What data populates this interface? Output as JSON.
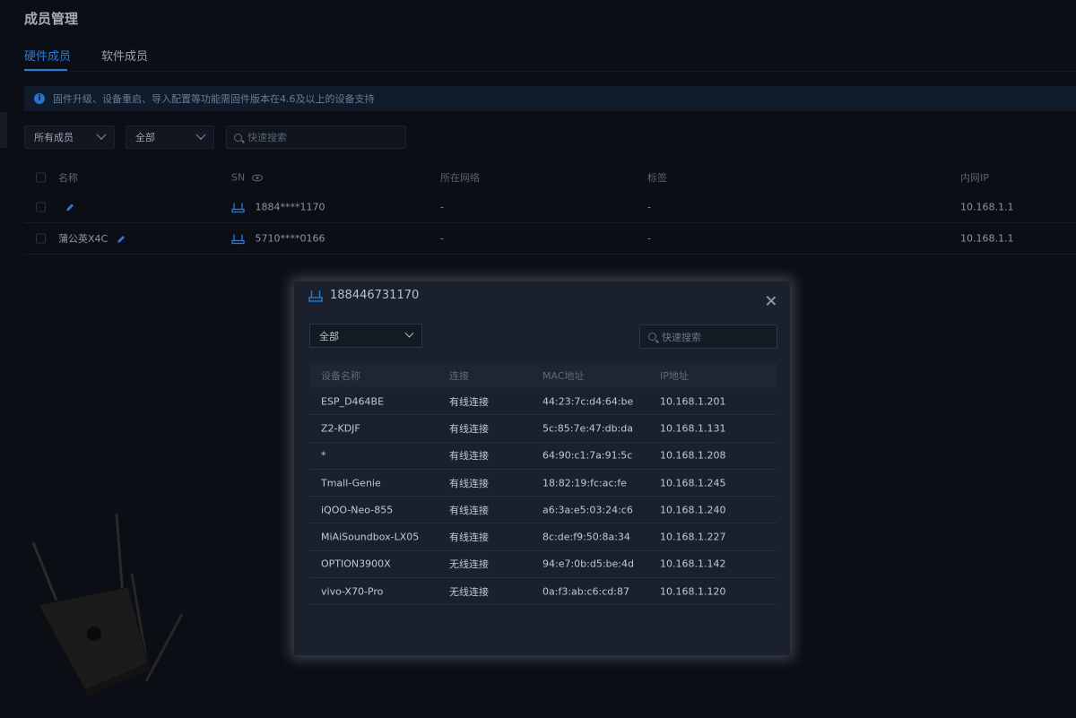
{
  "page": {
    "title": "成员管理",
    "tabs": [
      {
        "label": "硬件成员",
        "active": true
      },
      {
        "label": "软件成员",
        "active": false
      }
    ],
    "notice": "固件升级、设备重启、导入配置等功能需固件版本在4.6及以上的设备支持",
    "filters": {
      "member_select": "所有成员",
      "group_select": "全部",
      "search_placeholder": "快速搜索"
    },
    "table": {
      "columns": [
        "名称",
        "SN",
        "所在网络",
        "标签",
        "内网IP"
      ],
      "rows": [
        {
          "name": "",
          "sn": "1884****1170",
          "network": "-",
          "tag": "-",
          "ip": "10.168.1.1"
        },
        {
          "name": "蒲公英X4C",
          "sn": "5710****0166",
          "network": "-",
          "tag": "-",
          "ip": "10.168.1.1"
        }
      ]
    }
  },
  "modal": {
    "title": "188446731170",
    "select": "全部",
    "search_placeholder": "快速搜索",
    "columns": [
      "设备名称",
      "连接",
      "MAC地址",
      "IP地址"
    ],
    "rows": [
      {
        "name": "ESP_D464BE",
        "conn": "有线连接",
        "mac": "44:23:7c:d4:64:be",
        "ip": "10.168.1.201"
      },
      {
        "name": "Z2-KDJF",
        "conn": "有线连接",
        "mac": "5c:85:7e:47:db:da",
        "ip": "10.168.1.131"
      },
      {
        "name": "*",
        "conn": "有线连接",
        "mac": "64:90:c1:7a:91:5c",
        "ip": "10.168.1.208"
      },
      {
        "name": "Tmall-Genie",
        "conn": "有线连接",
        "mac": "18:82:19:fc:ac:fe",
        "ip": "10.168.1.245"
      },
      {
        "name": "iQOO-Neo-855",
        "conn": "有线连接",
        "mac": "a6:3a:e5:03:24:c6",
        "ip": "10.168.1.240"
      },
      {
        "name": "MiAiSoundbox-LX05",
        "conn": "有线连接",
        "mac": "8c:de:f9:50:8a:34",
        "ip": "10.168.1.227"
      },
      {
        "name": "OPTION3900X",
        "conn": "无线连接",
        "mac": "94:e7:0b:d5:be:4d",
        "ip": "10.168.1.142"
      },
      {
        "name": "vivo-X70-Pro",
        "conn": "无线连接",
        "mac": "0a:f3:ab:c6:cd:87",
        "ip": "10.168.1.120"
      }
    ]
  },
  "colors": {
    "accent": "#2a7ad6",
    "background": "#0b0e15",
    "modal_bg": "#1a212c"
  },
  "icons": [
    "info-icon",
    "chevron-down-icon",
    "search-icon",
    "pencil-icon",
    "eye-icon",
    "router-icon",
    "close-icon"
  ]
}
